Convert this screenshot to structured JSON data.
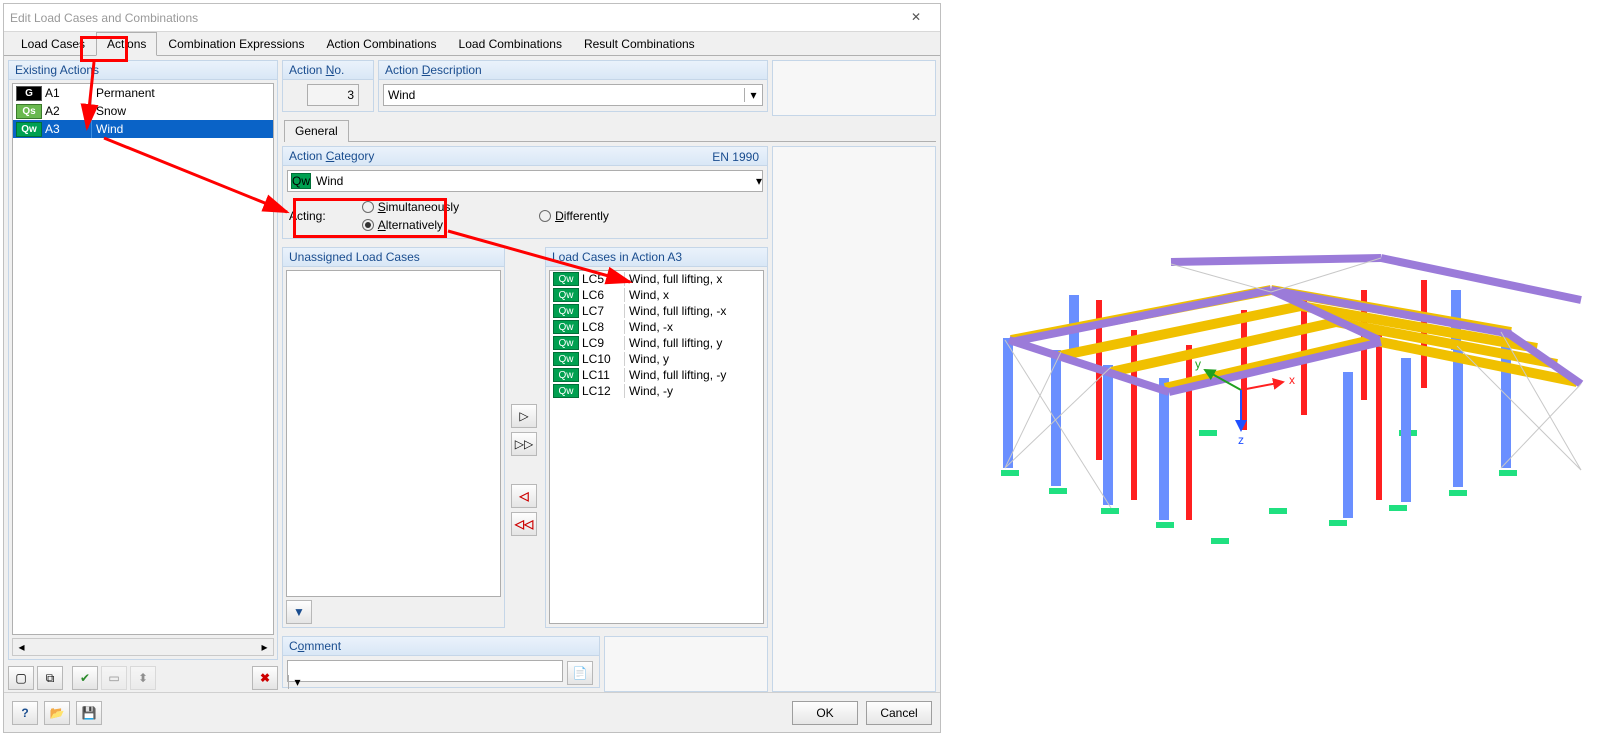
{
  "dialog_title": "Edit Load Cases and Combinations",
  "tabs": [
    "Load Cases",
    "Actions",
    "Combination Expressions",
    "Action Combinations",
    "Load Combinations",
    "Result Combinations"
  ],
  "active_tab": 1,
  "existing_actions_title": "Existing Actions",
  "actions": [
    {
      "badge": "G",
      "cls": "g",
      "id": "A1",
      "name": "Permanent"
    },
    {
      "badge": "Qs",
      "cls": "qs",
      "id": "A2",
      "name": "Snow"
    },
    {
      "badge": "Qw",
      "cls": "qw",
      "id": "A3",
      "name": "Wind"
    }
  ],
  "selected_action_index": 2,
  "action_no_label": "Action No.",
  "action_no_value": "3",
  "action_desc_label": "Action Description",
  "action_desc_value": "Wind",
  "subtab_general": "General",
  "action_category_label": "Action Category",
  "action_category_norm": "EN 1990",
  "action_category_value": "Wind",
  "acting_label": "Acting:",
  "acting_simul": "Simultaneously",
  "acting_alt": "Alternatively",
  "acting_diff": "Differently",
  "acting_selected": "alt",
  "unassigned_label": "Unassigned Load Cases",
  "assigned_label_prefix": "Load Cases in Action ",
  "assigned_label_id": "A3",
  "load_cases": [
    {
      "id": "LC5",
      "name": "Wind, full lifting, x"
    },
    {
      "id": "LC6",
      "name": "Wind, x"
    },
    {
      "id": "LC7",
      "name": "Wind, full lifting, -x"
    },
    {
      "id": "LC8",
      "name": "Wind, -x"
    },
    {
      "id": "LC9",
      "name": "Wind, full lifting, y"
    },
    {
      "id": "LC10",
      "name": "Wind, y"
    },
    {
      "id": "LC11",
      "name": "Wind, full lifting, -y"
    },
    {
      "id": "LC12",
      "name": "Wind, -y"
    }
  ],
  "comment_label": "Comment",
  "btn_ok": "OK",
  "btn_cancel": "Cancel",
  "axis_x": "x",
  "axis_y": "y",
  "axis_z": "z"
}
